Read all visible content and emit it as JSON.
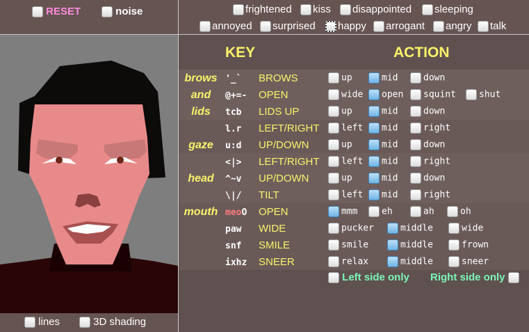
{
  "top_left": {
    "reset": "RESET",
    "noise": "noise"
  },
  "bottom_left": {
    "lines": "lines",
    "shading": "3D shading"
  },
  "emotions": [
    "frightened",
    "kiss",
    "disappointed",
    "sleeping",
    "annoyed",
    "surprised",
    "happy",
    "arrogant",
    "angry",
    "talk"
  ],
  "headers": {
    "key": "KEY",
    "action": "ACTION"
  },
  "groups": {
    "brows": "brows",
    "and": "and",
    "lids": "lids",
    "gaze": "gaze",
    "head": "head",
    "mouth": "mouth"
  },
  "rows": [
    {
      "keys": "'_`",
      "keys_red": "",
      "action": "BROWS",
      "options": [
        "up",
        "mid",
        "down"
      ],
      "selected": 1
    },
    {
      "keys": "@+=-",
      "keys_red": "",
      "action": "OPEN",
      "options": [
        "wide",
        "open",
        "squint",
        "shut"
      ],
      "selected": 1
    },
    {
      "keys": "tcb",
      "keys_red": "",
      "action": "LIDS UP",
      "options": [
        "up",
        "mid",
        "down"
      ],
      "selected": 1
    },
    {
      "keys": "l.r",
      "keys_red": "",
      "action": "LEFT/RIGHT",
      "options": [
        "left",
        "mid",
        "right"
      ],
      "selected": 1
    },
    {
      "keys": "u:d",
      "keys_red": "",
      "action": "UP/DOWN",
      "options": [
        "up",
        "mid",
        "down"
      ],
      "selected": 1
    },
    {
      "keys": "<|>",
      "keys_red": "",
      "action": "LEFT/RIGHT",
      "options": [
        "left",
        "mid",
        "right"
      ],
      "selected": 1
    },
    {
      "keys": "^~v",
      "keys_red": "",
      "action": "UP/DOWN",
      "options": [
        "up",
        "mid",
        "down"
      ],
      "selected": 1
    },
    {
      "keys": "\\|/",
      "keys_red": "",
      "action": "TILT",
      "options": [
        "left",
        "mid",
        "right"
      ],
      "selected": 1
    },
    {
      "keys": "O",
      "keys_red": "meo",
      "action": "OPEN",
      "options": [
        "mmm",
        "eh",
        "ah",
        "oh"
      ],
      "selected": 0
    },
    {
      "keys": "paw",
      "keys_red": "",
      "action": "WIDE",
      "options": [
        "pucker",
        "middle",
        "wide"
      ],
      "selected": 1
    },
    {
      "keys": "snf",
      "keys_red": "",
      "action": "SMILE",
      "options": [
        "smile",
        "middle",
        "frown"
      ],
      "selected": 1
    },
    {
      "keys": "ixhz",
      "keys_red": "",
      "action": "SNEER",
      "options": [
        "relax",
        "middle",
        "sneer"
      ],
      "selected": 1
    }
  ],
  "side_only": {
    "left": "Left side only",
    "right": "Right side only"
  },
  "colors": {
    "accent_yellow": "#fbf36a",
    "reset_pink": "#ff8adf",
    "side_green": "#7df5b8",
    "key_red": "#ff7a7a"
  }
}
